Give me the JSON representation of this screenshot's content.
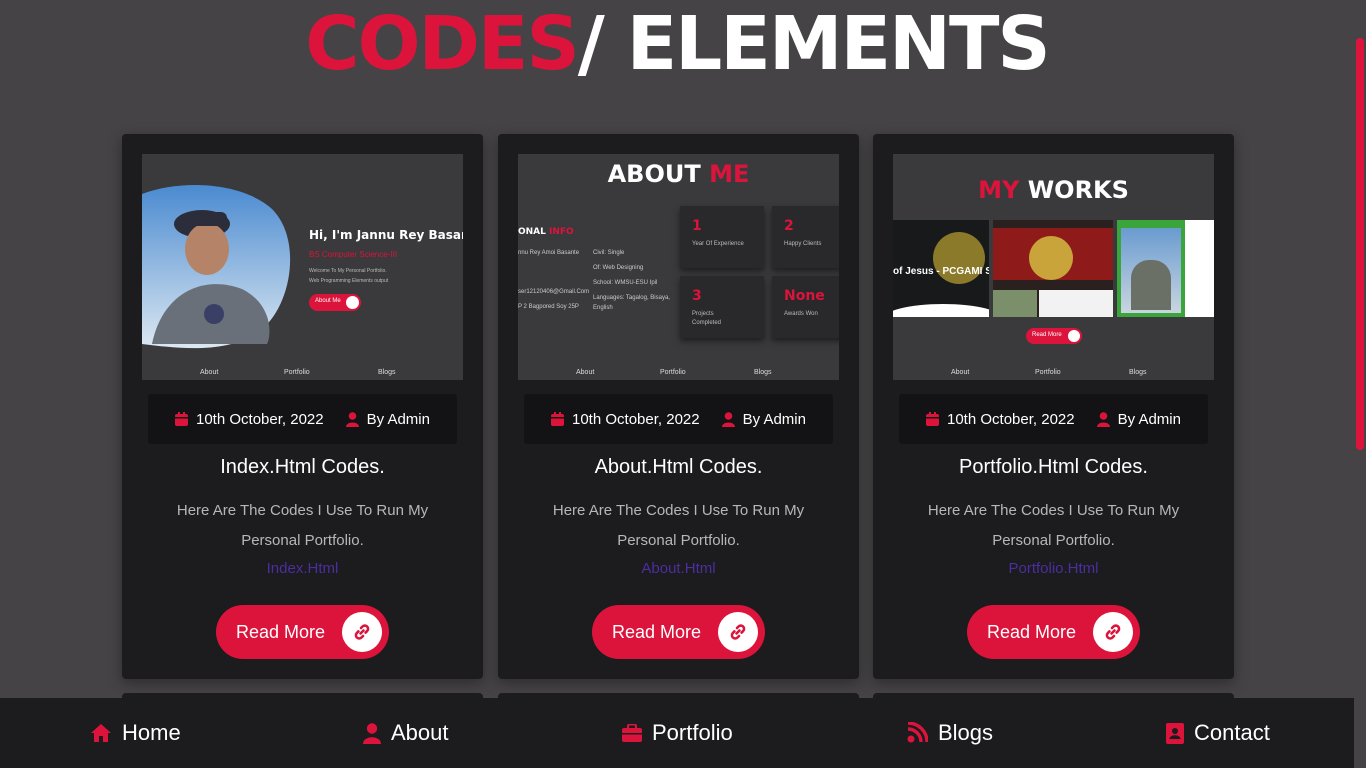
{
  "heading": {
    "accent": "CODES",
    "rest": "/ ELEMENTS"
  },
  "colors": {
    "accent": "#dc143c",
    "background": "#454345",
    "card": "#1c1b1d",
    "link": "#4b2ea0"
  },
  "cards": [
    {
      "date": "10th October, 2022",
      "author": "By Admin",
      "title": "Index.Html Codes.",
      "description": "Here Are The Codes I Use To Run My Personal Portfolio.",
      "link": "Index.Html",
      "button": "Read More",
      "preview": {
        "greeting": "Hi, I'm Jannu Rey Basar",
        "subtitle": "BS Computer Science-III",
        "line1": "Welcome To My Personal Portfolio.",
        "line2": "Web Programming Elements output",
        "about_button": "About Me",
        "nav": [
          "About",
          "Portfolio",
          "Blogs"
        ]
      }
    },
    {
      "date": "10th October, 2022",
      "author": "By Admin",
      "title": "About.Html Codes.",
      "description": "Here Are The Codes I Use To Run My Personal Portfolio.",
      "link": "About.Html",
      "button": "Read More",
      "preview": {
        "title_a": "ABOUT",
        "title_b": "ME",
        "info_a": "ONAL",
        "info_b": "INFO",
        "info_lines": [
          "nnu Rey Amoi Basante",
          "Civil:   Single",
          "Of:   Web Designing",
          "School:   WMSU-ESU Ipil",
          "ser12120406@Gmail.Com",
          "Languages: Tagalog, Bisaya,",
          "P  2 Bagpored Soy 25P",
          "English"
        ],
        "stats": [
          {
            "value": "1",
            "label": "Year Of Experience"
          },
          {
            "value": "2",
            "label": "Happy Clients"
          },
          {
            "value": "3",
            "label": "Projects Completed"
          },
          {
            "value": "None",
            "label": "Awards Won"
          }
        ],
        "nav": [
          "About",
          "Portfolio",
          "Blogs"
        ]
      }
    },
    {
      "date": "10th October, 2022",
      "author": "By Admin",
      "title": "Portfolio.Html Codes.",
      "description": "Here Are The Codes I Use To Run My Personal Portfolio.",
      "link": "Portfolio.Html",
      "button": "Read More",
      "preview": {
        "title_a": "MY",
        "title_b": "WORKS",
        "shot1": "of Jesus - PCGAMI S",
        "read_more": "Read More",
        "nav": [
          "About",
          "Portfolio",
          "Blogs"
        ]
      }
    }
  ],
  "nav": [
    {
      "label": "Home",
      "icon": "home-icon"
    },
    {
      "label": "About",
      "icon": "user-icon"
    },
    {
      "label": "Portfolio",
      "icon": "briefcase-icon"
    },
    {
      "label": "Blogs",
      "icon": "rss-icon"
    },
    {
      "label": "Contact",
      "icon": "address-book-icon"
    }
  ]
}
